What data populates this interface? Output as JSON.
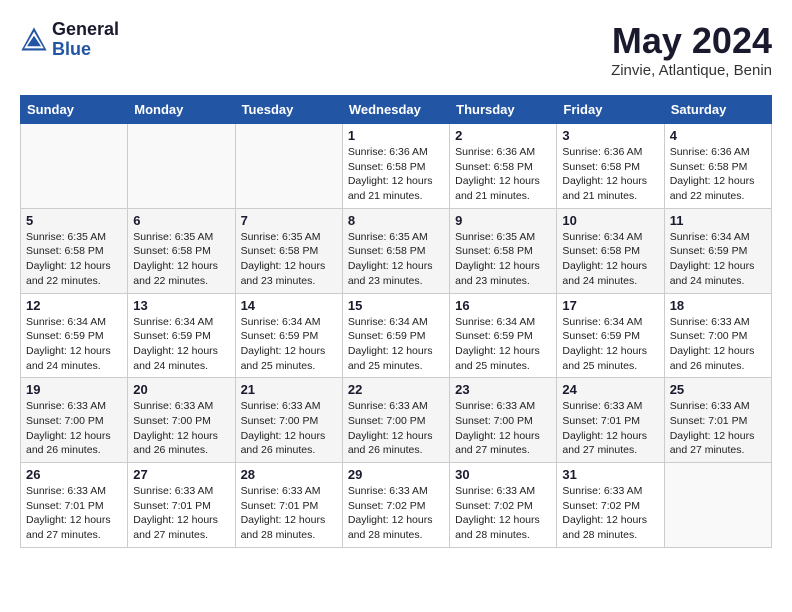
{
  "header": {
    "logo": {
      "general": "General",
      "blue": "Blue"
    },
    "title": "May 2024",
    "subtitle": "Zinvie, Atlantique, Benin"
  },
  "weekdays": [
    "Sunday",
    "Monday",
    "Tuesday",
    "Wednesday",
    "Thursday",
    "Friday",
    "Saturday"
  ],
  "weeks": [
    [
      {
        "day": "",
        "info": ""
      },
      {
        "day": "",
        "info": ""
      },
      {
        "day": "",
        "info": ""
      },
      {
        "day": "1",
        "info": "Sunrise: 6:36 AM\nSunset: 6:58 PM\nDaylight: 12 hours\nand 21 minutes."
      },
      {
        "day": "2",
        "info": "Sunrise: 6:36 AM\nSunset: 6:58 PM\nDaylight: 12 hours\nand 21 minutes."
      },
      {
        "day": "3",
        "info": "Sunrise: 6:36 AM\nSunset: 6:58 PM\nDaylight: 12 hours\nand 21 minutes."
      },
      {
        "day": "4",
        "info": "Sunrise: 6:36 AM\nSunset: 6:58 PM\nDaylight: 12 hours\nand 22 minutes."
      }
    ],
    [
      {
        "day": "5",
        "info": "Sunrise: 6:35 AM\nSunset: 6:58 PM\nDaylight: 12 hours\nand 22 minutes."
      },
      {
        "day": "6",
        "info": "Sunrise: 6:35 AM\nSunset: 6:58 PM\nDaylight: 12 hours\nand 22 minutes."
      },
      {
        "day": "7",
        "info": "Sunrise: 6:35 AM\nSunset: 6:58 PM\nDaylight: 12 hours\nand 23 minutes."
      },
      {
        "day": "8",
        "info": "Sunrise: 6:35 AM\nSunset: 6:58 PM\nDaylight: 12 hours\nand 23 minutes."
      },
      {
        "day": "9",
        "info": "Sunrise: 6:35 AM\nSunset: 6:58 PM\nDaylight: 12 hours\nand 23 minutes."
      },
      {
        "day": "10",
        "info": "Sunrise: 6:34 AM\nSunset: 6:58 PM\nDaylight: 12 hours\nand 24 minutes."
      },
      {
        "day": "11",
        "info": "Sunrise: 6:34 AM\nSunset: 6:59 PM\nDaylight: 12 hours\nand 24 minutes."
      }
    ],
    [
      {
        "day": "12",
        "info": "Sunrise: 6:34 AM\nSunset: 6:59 PM\nDaylight: 12 hours\nand 24 minutes."
      },
      {
        "day": "13",
        "info": "Sunrise: 6:34 AM\nSunset: 6:59 PM\nDaylight: 12 hours\nand 24 minutes."
      },
      {
        "day": "14",
        "info": "Sunrise: 6:34 AM\nSunset: 6:59 PM\nDaylight: 12 hours\nand 25 minutes."
      },
      {
        "day": "15",
        "info": "Sunrise: 6:34 AM\nSunset: 6:59 PM\nDaylight: 12 hours\nand 25 minutes."
      },
      {
        "day": "16",
        "info": "Sunrise: 6:34 AM\nSunset: 6:59 PM\nDaylight: 12 hours\nand 25 minutes."
      },
      {
        "day": "17",
        "info": "Sunrise: 6:34 AM\nSunset: 6:59 PM\nDaylight: 12 hours\nand 25 minutes."
      },
      {
        "day": "18",
        "info": "Sunrise: 6:33 AM\nSunset: 7:00 PM\nDaylight: 12 hours\nand 26 minutes."
      }
    ],
    [
      {
        "day": "19",
        "info": "Sunrise: 6:33 AM\nSunset: 7:00 PM\nDaylight: 12 hours\nand 26 minutes."
      },
      {
        "day": "20",
        "info": "Sunrise: 6:33 AM\nSunset: 7:00 PM\nDaylight: 12 hours\nand 26 minutes."
      },
      {
        "day": "21",
        "info": "Sunrise: 6:33 AM\nSunset: 7:00 PM\nDaylight: 12 hours\nand 26 minutes."
      },
      {
        "day": "22",
        "info": "Sunrise: 6:33 AM\nSunset: 7:00 PM\nDaylight: 12 hours\nand 26 minutes."
      },
      {
        "day": "23",
        "info": "Sunrise: 6:33 AM\nSunset: 7:00 PM\nDaylight: 12 hours\nand 27 minutes."
      },
      {
        "day": "24",
        "info": "Sunrise: 6:33 AM\nSunset: 7:01 PM\nDaylight: 12 hours\nand 27 minutes."
      },
      {
        "day": "25",
        "info": "Sunrise: 6:33 AM\nSunset: 7:01 PM\nDaylight: 12 hours\nand 27 minutes."
      }
    ],
    [
      {
        "day": "26",
        "info": "Sunrise: 6:33 AM\nSunset: 7:01 PM\nDaylight: 12 hours\nand 27 minutes."
      },
      {
        "day": "27",
        "info": "Sunrise: 6:33 AM\nSunset: 7:01 PM\nDaylight: 12 hours\nand 27 minutes."
      },
      {
        "day": "28",
        "info": "Sunrise: 6:33 AM\nSunset: 7:01 PM\nDaylight: 12 hours\nand 28 minutes."
      },
      {
        "day": "29",
        "info": "Sunrise: 6:33 AM\nSunset: 7:02 PM\nDaylight: 12 hours\nand 28 minutes."
      },
      {
        "day": "30",
        "info": "Sunrise: 6:33 AM\nSunset: 7:02 PM\nDaylight: 12 hours\nand 28 minutes."
      },
      {
        "day": "31",
        "info": "Sunrise: 6:33 AM\nSunset: 7:02 PM\nDaylight: 12 hours\nand 28 minutes."
      },
      {
        "day": "",
        "info": ""
      }
    ]
  ]
}
